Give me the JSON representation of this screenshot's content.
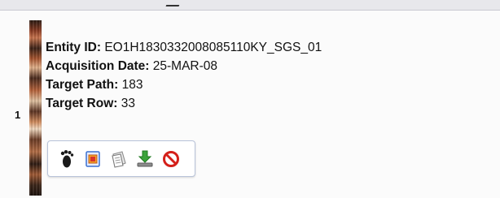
{
  "row": {
    "number": "1",
    "fields": [
      {
        "key": "Entity ID:",
        "value": "EO1H1830332008085110KY_SGS_01"
      },
      {
        "key": "Acquisition Date:",
        "value": "25-MAR-08"
      },
      {
        "key": "Target Path:",
        "value": "183"
      },
      {
        "key": "Target Row:",
        "value": "33"
      }
    ],
    "actions": [
      {
        "name": "footprint-icon"
      },
      {
        "name": "browse-overlay-icon"
      },
      {
        "name": "metadata-icon"
      },
      {
        "name": "download-icon"
      },
      {
        "name": "exclude-icon"
      }
    ]
  },
  "colors": {
    "panel_border": "#b8c3d9",
    "exclude_red": "#d4201a",
    "overlay_blue": "#3a6fd1"
  }
}
